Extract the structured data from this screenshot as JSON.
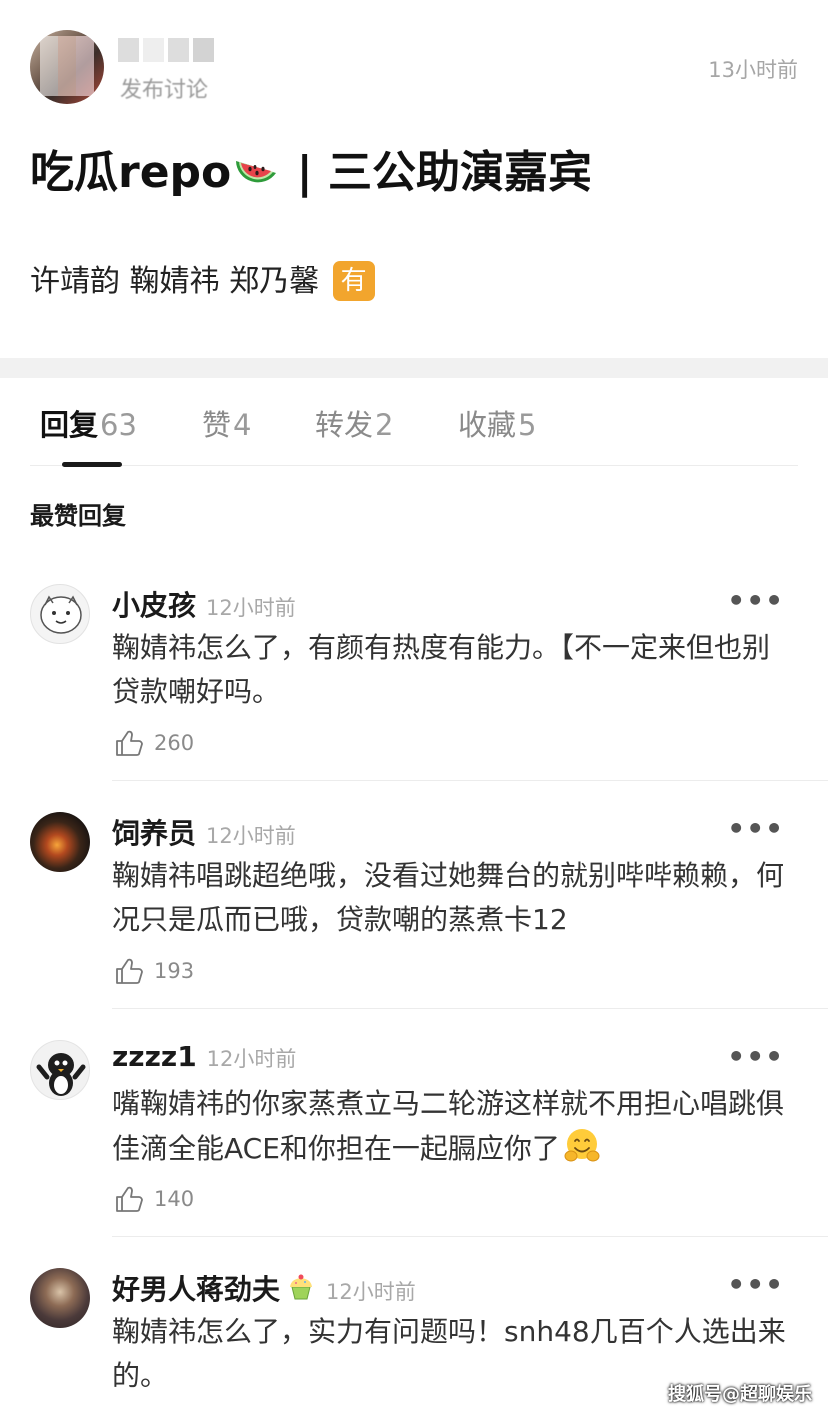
{
  "post": {
    "action": "发布讨论",
    "time": "13小时前",
    "title_prefix": "吃瓜repo",
    "title_emoji": "watermelon-icon",
    "title_suffix": " | 三公助演嘉宾",
    "body": "许靖韵 鞠婧祎 郑乃馨",
    "badge": "有"
  },
  "tabs": [
    {
      "label": "回复",
      "count": "63"
    },
    {
      "label": "赞",
      "count": "4"
    },
    {
      "label": "转发",
      "count": "2"
    },
    {
      "label": "收藏",
      "count": "5"
    }
  ],
  "section_label": "最赞回复",
  "comments": [
    {
      "name": "小皮孩",
      "time": "12小时前",
      "text": "鞠婧祎怎么了，有颜有热度有能力。【不一定来但也别贷款嘲好吗。",
      "likes": "260",
      "more": "•••"
    },
    {
      "name": "饲养员",
      "time": "12小时前",
      "text": "鞠婧祎唱跳超绝哦，没看过她舞台的就别哔哔赖赖，何况只是瓜而已哦，贷款嘲的蒸煮卡12",
      "likes": "193",
      "more": "•••"
    },
    {
      "name": "zzzz1",
      "time": "12小时前",
      "text": "嘴鞠婧祎的你家蒸煮立马二轮游这样就不用担心唱跳俱佳滴全能ACE和你担在一起膈应你了",
      "likes": "140",
      "more": "•••"
    },
    {
      "name": "好男人蒋劲夫",
      "time": "12小时前",
      "text": "鞠婧祎怎么了，实力有问题吗！snh48几百个人选出来的。",
      "likes": "",
      "more": "•••"
    }
  ],
  "watermark": "搜狐号@超聊娱乐",
  "colors": {
    "badge": "#f2a52d",
    "divider": "#f1f1f1",
    "text_muted": "#a8a8a8"
  }
}
